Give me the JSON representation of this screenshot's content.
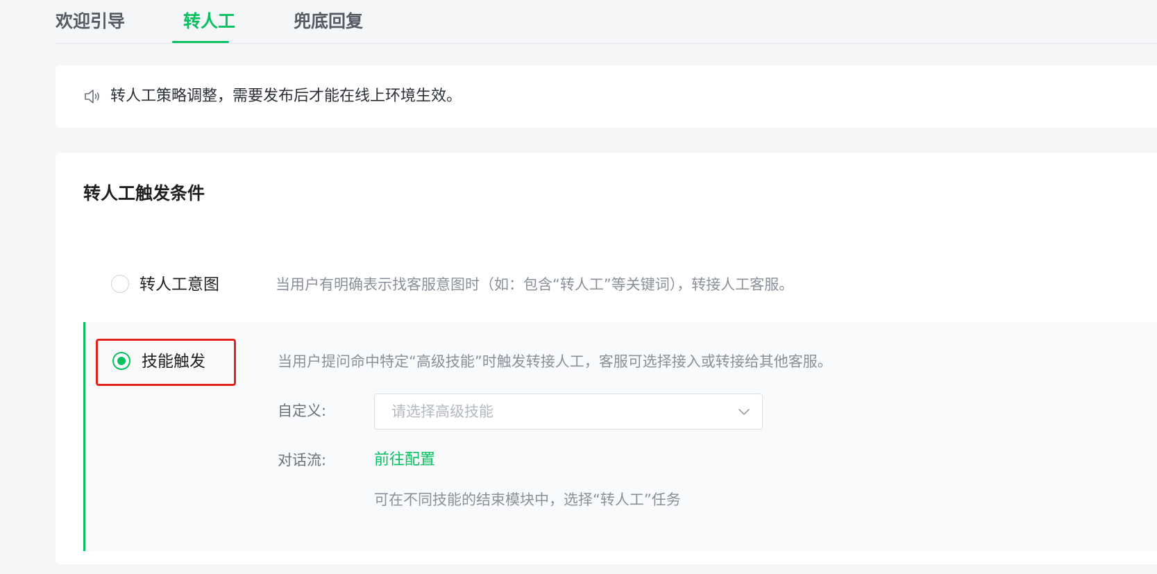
{
  "tabs": [
    {
      "label": "欢迎引导",
      "active": false
    },
    {
      "label": "转人工",
      "active": true
    },
    {
      "label": "兜底回复",
      "active": false
    }
  ],
  "notice": {
    "icon": "speaker-icon",
    "text": "转人工策略调整，需要发布后才能在线上环境生效。"
  },
  "trigger": {
    "title": "转人工触发条件",
    "options": [
      {
        "label": "转人工意图",
        "description": "当用户有明确表示找客服意图时（如：包含“转人工”等关键词），转接人工客服。",
        "selected": false
      },
      {
        "label": "技能触发",
        "description": "当用户提问命中特定“高级技能”时触发转接人工，客服可选择接入或转接给其他客服。",
        "selected": true,
        "custom_label": "自定义:",
        "select_placeholder": "请选择高级技能",
        "flow_label": "对话流:",
        "flow_link": "前往配置",
        "flow_hint": "可在不同技能的结束模块中，选择“转人工”任务"
      }
    ]
  },
  "colors": {
    "accent": "#07c160",
    "highlight_border": "#e5221c",
    "background": "#f5f6f8"
  }
}
